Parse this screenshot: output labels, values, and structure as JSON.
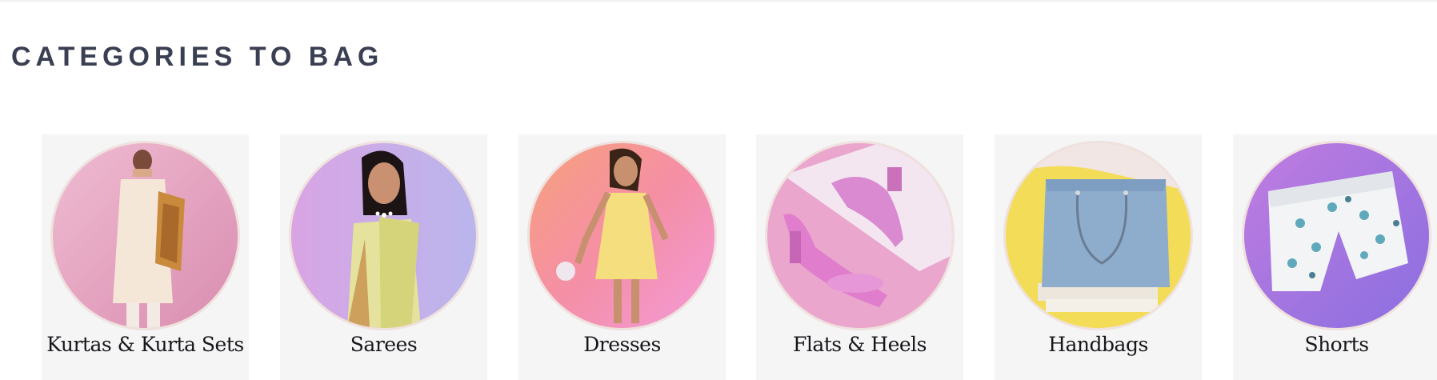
{
  "section": {
    "title": "CATEGORIES TO BAG"
  },
  "categories": [
    {
      "label": "Kurtas & Kurta Sets",
      "icon": "kurta-model-photo",
      "bg": "#e6a7c4"
    },
    {
      "label": "Sarees",
      "icon": "saree-model-photo",
      "bg": "#c7a9e6"
    },
    {
      "label": "Dresses",
      "icon": "dress-model-photo",
      "bg": "#f4a0b0"
    },
    {
      "label": "Flats & Heels",
      "icon": "heels-photo",
      "bg": "#eaa6cc"
    },
    {
      "label": "Handbags",
      "icon": "handbag-photo",
      "bg": "#f3e26a"
    },
    {
      "label": "Shorts",
      "icon": "shorts-photo",
      "bg": "#a98ae3"
    }
  ],
  "colors": {
    "title": "#3a3f52",
    "card_bg": "#f5f5f6",
    "label": "#17171b"
  }
}
